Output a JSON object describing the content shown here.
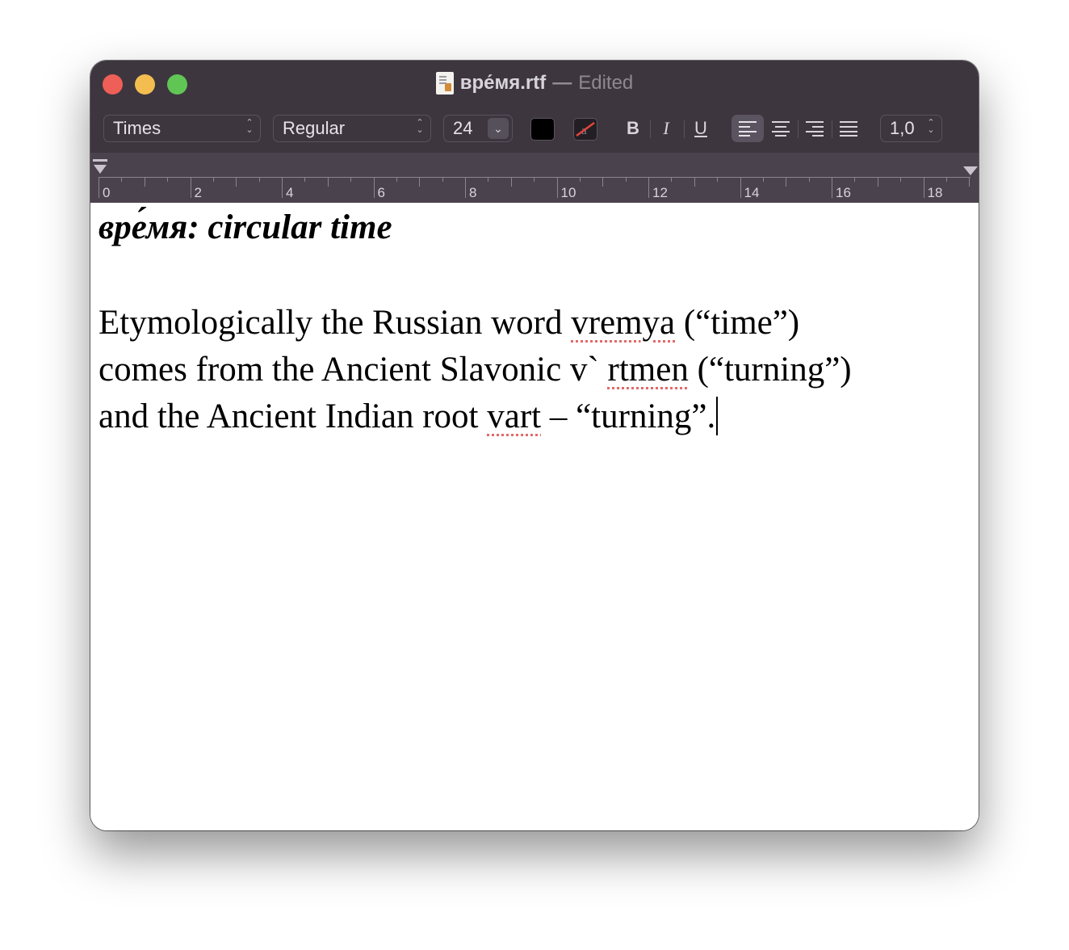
{
  "window": {
    "filename": "вре́мя.rtf",
    "separator": "—",
    "state": "Edited"
  },
  "toolbar": {
    "font_family": "Times",
    "font_style": "Regular",
    "font_size": "24",
    "bold_label": "B",
    "italic_label": "I",
    "underline_label": "U",
    "line_spacing": "1,0",
    "text_color": "#000000",
    "active_alignment": "left"
  },
  "ruler": {
    "labels": [
      "0",
      "2",
      "4",
      "6",
      "8",
      "10",
      "12",
      "14",
      "16",
      "18"
    ]
  },
  "document": {
    "heading": "вре́мя: circular time",
    "line1": {
      "a": "Etymologically the Russian word ",
      "b": "vremya",
      "c": " (“time”)"
    },
    "line2": {
      "a": "comes from the Ancient Slavonic v` ",
      "b": "rtmen",
      "c": " (“turning”)"
    },
    "line3": {
      "a": "and the Ancient Indian root ",
      "b": "vart",
      "c": " – “turning”."
    }
  }
}
